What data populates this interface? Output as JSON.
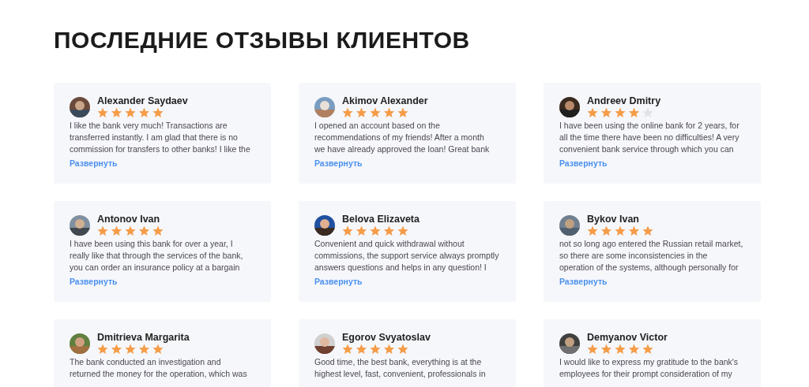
{
  "heading": "ПОСЛЕДНИЕ ОТЗЫВЫ КЛИЕНТОВ",
  "reviews": [
    {
      "name": "Alexander Saydaev",
      "stars": 5,
      "lines": [
        "I like the bank very much! Transactions are",
        "transferred instantly. I am glad that there is no",
        "commission for transfers to other banks! I like the"
      ],
      "expand": "Развернуть"
    },
    {
      "name": "Akimov Alexander",
      "stars": 5,
      "lines": [
        "I opened an account based on the",
        "recommendations of my friends! After a month",
        "we have already approved the loan! Great bank"
      ],
      "expand": "Развернуть"
    },
    {
      "name": "Andreev Dmitry",
      "stars": 4,
      "lines": [
        "I have been using the online bank for 2 years, for",
        "all the time there have been no difficulties! A very",
        "convenient bank service through which you can"
      ],
      "expand": "Развернуть"
    },
    {
      "name": "Antonov Ivan",
      "stars": 5,
      "lines": [
        "I have been using this bank for over a year, I",
        "really like that through the services of the bank,",
        "you can order an insurance policy at a bargain"
      ],
      "expand": "Развернуть"
    },
    {
      "name": "Belova Elizaveta",
      "stars": 5,
      "lines": [
        "Convenient and quick withdrawal without",
        "commissions, the support service always promptly",
        "answers questions and helps in any question! I"
      ],
      "expand": "Развернуть"
    },
    {
      "name": "Bykov Ivan",
      "stars": 5,
      "lines": [
        "not so long ago entered the Russian retail market,",
        "so there are some inconsistencies in the",
        "operation of the systems, although personally for"
      ],
      "expand": "Развернуть"
    },
    {
      "name": "Dmitrieva Margarita",
      "stars": 5,
      "lines": [
        "The bank conducted an investigation and",
        "returned the money for the operation, which was"
      ]
    },
    {
      "name": "Egorov Svyatoslav",
      "stars": 5,
      "lines": [
        "Good time, the best bank, everything is at the",
        "highest level, fast, convenient, professionals in"
      ]
    },
    {
      "name": "Demyanov Victor",
      "stars": 5,
      "lines": [
        "I would like to express my gratitude to the bank's",
        "employees for their prompt consideration of my"
      ]
    }
  ]
}
